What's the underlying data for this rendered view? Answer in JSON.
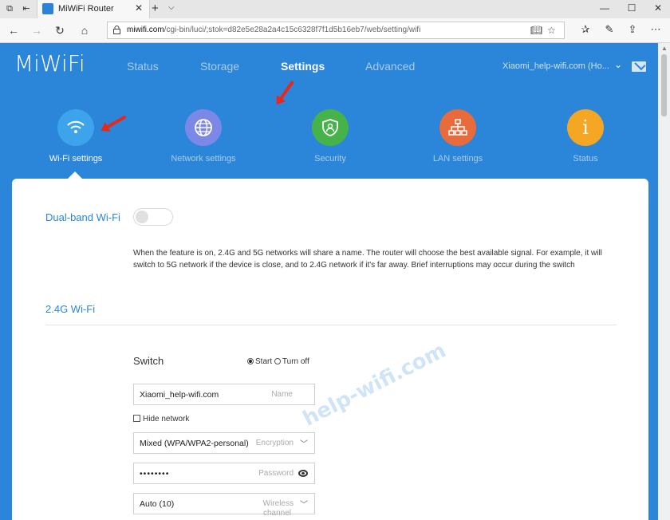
{
  "browser": {
    "tab_title": "MiWiFi Router",
    "url_domain": "miwifi.com",
    "url_path": "/cgi-bin/luci/;stok=d82e5e28a2a4c15c6328f7f1d5b16eb7/web/setting/wifi"
  },
  "header": {
    "logo": "MiWiFi",
    "nav": [
      "Status",
      "Storage",
      "Settings",
      "Advanced"
    ],
    "active_nav": "Settings",
    "router_name": "Xiaomi_help-wifi.com (Ho..."
  },
  "categories": [
    {
      "label": "Wi-Fi settings",
      "color": "#3da4ec",
      "icon": "wifi-icon"
    },
    {
      "label": "Network settings",
      "color": "#7b88e6",
      "icon": "globe-icon"
    },
    {
      "label": "Security",
      "color": "#45b24a",
      "icon": "shield-icon"
    },
    {
      "label": "LAN settings",
      "color": "#e86b3c",
      "icon": "lan-icon"
    },
    {
      "label": "Status",
      "color": "#f5a623",
      "icon": "info-icon"
    }
  ],
  "dual_band": {
    "title": "Dual-band Wi-Fi",
    "enabled": false,
    "description": "When the feature is on, 2.4G and 5G networks will share a name. The router will choose the best available signal. For example, it will switch to 5G network if the device is close, and to 2.4G network if it's far away. Brief interruptions may occur during the switch"
  },
  "wifi24": {
    "title": "2.4G Wi-Fi",
    "switch_label": "Switch",
    "switch_options": [
      "Start",
      "Turn off"
    ],
    "switch_selected": "Start",
    "name_value": "Xiaomi_help-wifi.com",
    "name_hint": "Name",
    "hide_network_label": "Hide network",
    "encryption_value": "Mixed (WPA/WPA2-personal)",
    "encryption_hint": "Encryption",
    "password_value": "••••••••",
    "password_hint": "Password",
    "channel_value": "Auto (10)",
    "channel_hint": "Wireless",
    "channel_hint_2": "channel"
  },
  "watermark": "help-wifi.com"
}
